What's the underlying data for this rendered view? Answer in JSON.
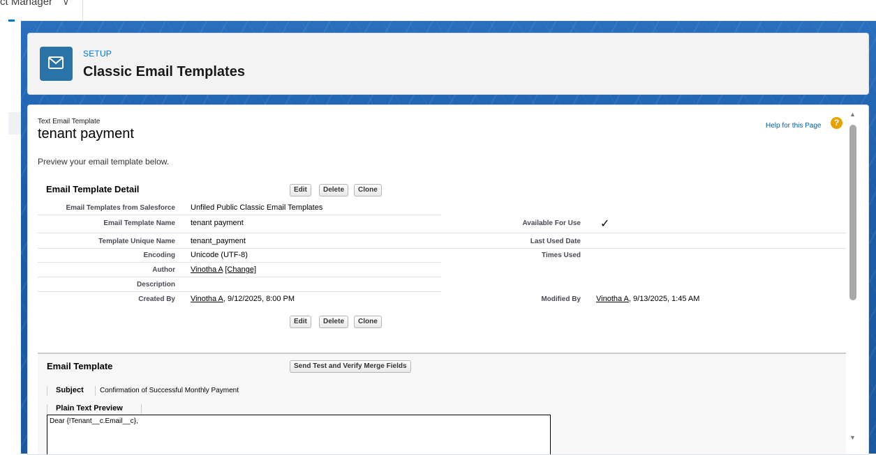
{
  "app": {
    "name": "ct Manager"
  },
  "header": {
    "setup_label": "SETUP",
    "title": "Classic Email Templates"
  },
  "template": {
    "type_label": "Text Email Template",
    "name": "tenant payment",
    "help_link": "Help for this Page",
    "preview_text": "Preview your email template below."
  },
  "detail": {
    "section_title": "Email Template Detail",
    "buttons": {
      "edit": "Edit",
      "delete": "Delete",
      "clone": "Clone"
    },
    "fields": {
      "folder_label": "Email Templates from Salesforce",
      "folder_value": "Unfiled Public Classic Email Templates",
      "name_label": "Email Template Name",
      "name_value": "tenant payment",
      "unique_label": "Template Unique Name",
      "unique_value": "tenant_payment",
      "encoding_label": "Encoding",
      "encoding_value": "Unicode (UTF-8)",
      "author_label": "Author",
      "author_value": "Vinotha A",
      "author_change": "[Change]",
      "description_label": "Description",
      "created_label": "Created By",
      "created_user": "Vinotha A",
      "created_date": ", 9/12/2025, 8:00 PM",
      "available_label": "Available For Use",
      "last_used_label": "Last Used Date",
      "times_used_label": "Times Used",
      "modified_label": "Modified By",
      "modified_user": "Vinotha A",
      "modified_date": ", 9/13/2025, 1:45 AM"
    }
  },
  "email_template": {
    "section_title": "Email Template",
    "send_test_button": "Send Test and Verify Merge Fields",
    "subject_label": "Subject",
    "subject_value": "Confirmation of Successful Monthly Payment",
    "plain_text_label": "Plain Text Preview",
    "plain_text_body": "Dear {!Tenant__c.Email__c},"
  },
  "colors": {
    "brand_blue": "#0176d3",
    "icon_tile": "#2a73a8",
    "help_icon": "#e8a200"
  },
  "icons": {
    "header": "envelope-icon",
    "help": "help-icon",
    "available": "checkmark-icon"
  }
}
